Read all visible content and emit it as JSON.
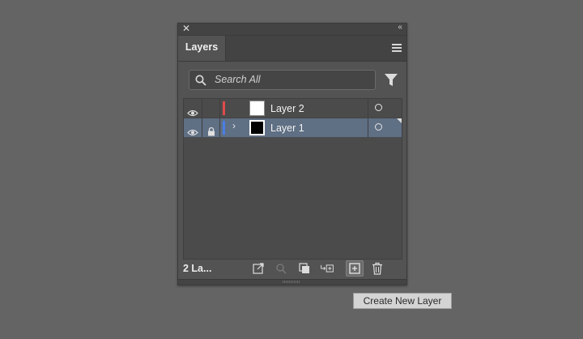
{
  "panel": {
    "title_tab": "Layers",
    "close_icon": "close-icon",
    "collapse_icon": "collapse-icon",
    "menu_icon": "panel-menu-icon"
  },
  "search": {
    "placeholder": "Search All",
    "icon": "search-icon",
    "filter_icon": "filter-icon"
  },
  "layers": [
    {
      "name": "Layer 2",
      "visible": true,
      "locked": false,
      "color": "#e04b4b",
      "expandable": false,
      "thumbnail": "white",
      "selected": false
    },
    {
      "name": "Layer 1",
      "visible": true,
      "locked": true,
      "color": "#4a7ee6",
      "expandable": true,
      "thumbnail": "black",
      "selected": true
    }
  ],
  "footer": {
    "count_label": "2 La...",
    "buttons": [
      "export-icon",
      "locate-object-icon",
      "make-clipping-mask-icon",
      "create-sublayer-icon",
      "create-new-layer-icon",
      "trash-icon"
    ]
  },
  "tooltip": "Create New Layer",
  "colors": {
    "background": "#646464",
    "panel": "#535353",
    "selected_row": "#5f6f84"
  }
}
